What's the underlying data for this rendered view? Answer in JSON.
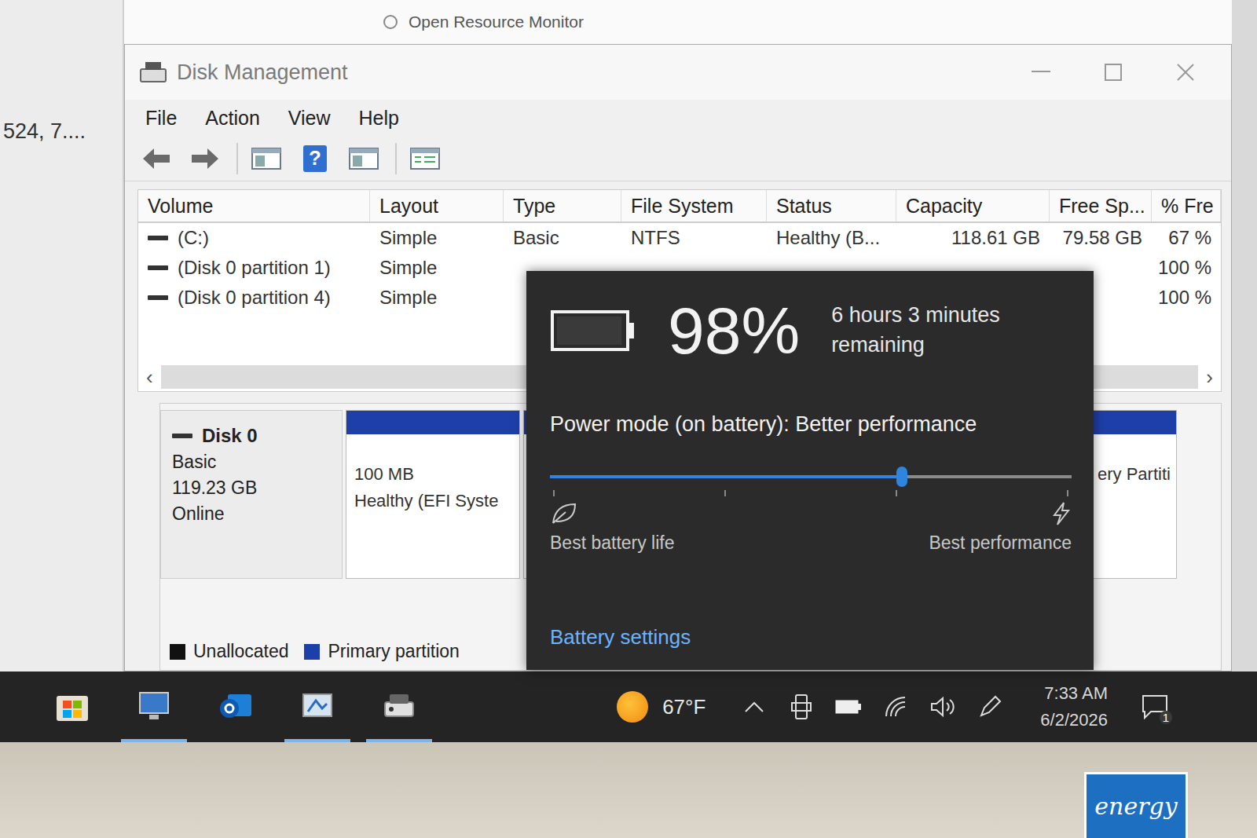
{
  "background_window": {
    "link": "Open Resource Monitor",
    "side_text": "524, 7...."
  },
  "window": {
    "title": "Disk Management"
  },
  "menu": [
    "File",
    "Action",
    "View",
    "Help"
  ],
  "toolbar": [
    {
      "kind": "back"
    },
    {
      "kind": "forward"
    },
    {
      "kind": "console"
    },
    {
      "kind": "help",
      "glyph": "?"
    },
    {
      "kind": "pane"
    },
    {
      "kind": "list"
    }
  ],
  "table": {
    "columns": [
      "Volume",
      "Layout",
      "Type",
      "File System",
      "Status",
      "Capacity",
      "Free Sp...",
      "% Fre"
    ],
    "rows": [
      {
        "cells": [
          "(C:)",
          "Simple",
          "Basic",
          "NTFS",
          "Healthy (B...",
          "118.61 GB",
          "79.58 GB",
          "67 %"
        ],
        "selected": false
      },
      {
        "cells": [
          "(Disk 0 partition 1)",
          "Simple",
          "",
          "",
          "",
          "",
          "",
          "100 %"
        ],
        "selected": false
      },
      {
        "cells": [
          "(Disk 0 partition 4)",
          "Simple",
          "",
          "",
          "",
          "",
          "",
          "100 %"
        ],
        "selected": false
      }
    ]
  },
  "scrollbar": {
    "left": "‹",
    "right": "›"
  },
  "disk": {
    "name": "Disk 0",
    "type": "Basic",
    "size": "119.23 GB",
    "status": "Online"
  },
  "partitions": [
    {
      "kind": "efi",
      "lines": [
        "100 MB",
        "Healthy (EFI Syste"
      ]
    },
    {
      "kind": "main",
      "lines": []
    },
    {
      "kind": "recovery",
      "lines": [
        "ery Partiti"
      ]
    }
  ],
  "legend": [
    {
      "label": "Unallocated",
      "color": "#111111"
    },
    {
      "label": "Primary partition",
      "color": "#1f3fa8"
    }
  ],
  "battery_flyout": {
    "percent": "98%",
    "level": 0.98,
    "remaining": "6 hours 3 minutes remaining",
    "power_mode": "Power mode (on battery): Better performance",
    "slider_level": 0.675,
    "min_label": "Best battery life",
    "max_label": "Best performance",
    "link": "Battery settings"
  },
  "taskbar": {
    "apps": [
      {
        "name": "store",
        "active": false
      },
      {
        "name": "monitor",
        "active": true
      },
      {
        "name": "outlook",
        "active": false
      },
      {
        "name": "paint",
        "active": true
      },
      {
        "name": "disk-management",
        "active": true
      }
    ],
    "weather": "67°F",
    "time": "7:33 AM",
    "date": "6/2/2026",
    "notifications": "1"
  },
  "energy_star": {
    "text": "energy"
  }
}
